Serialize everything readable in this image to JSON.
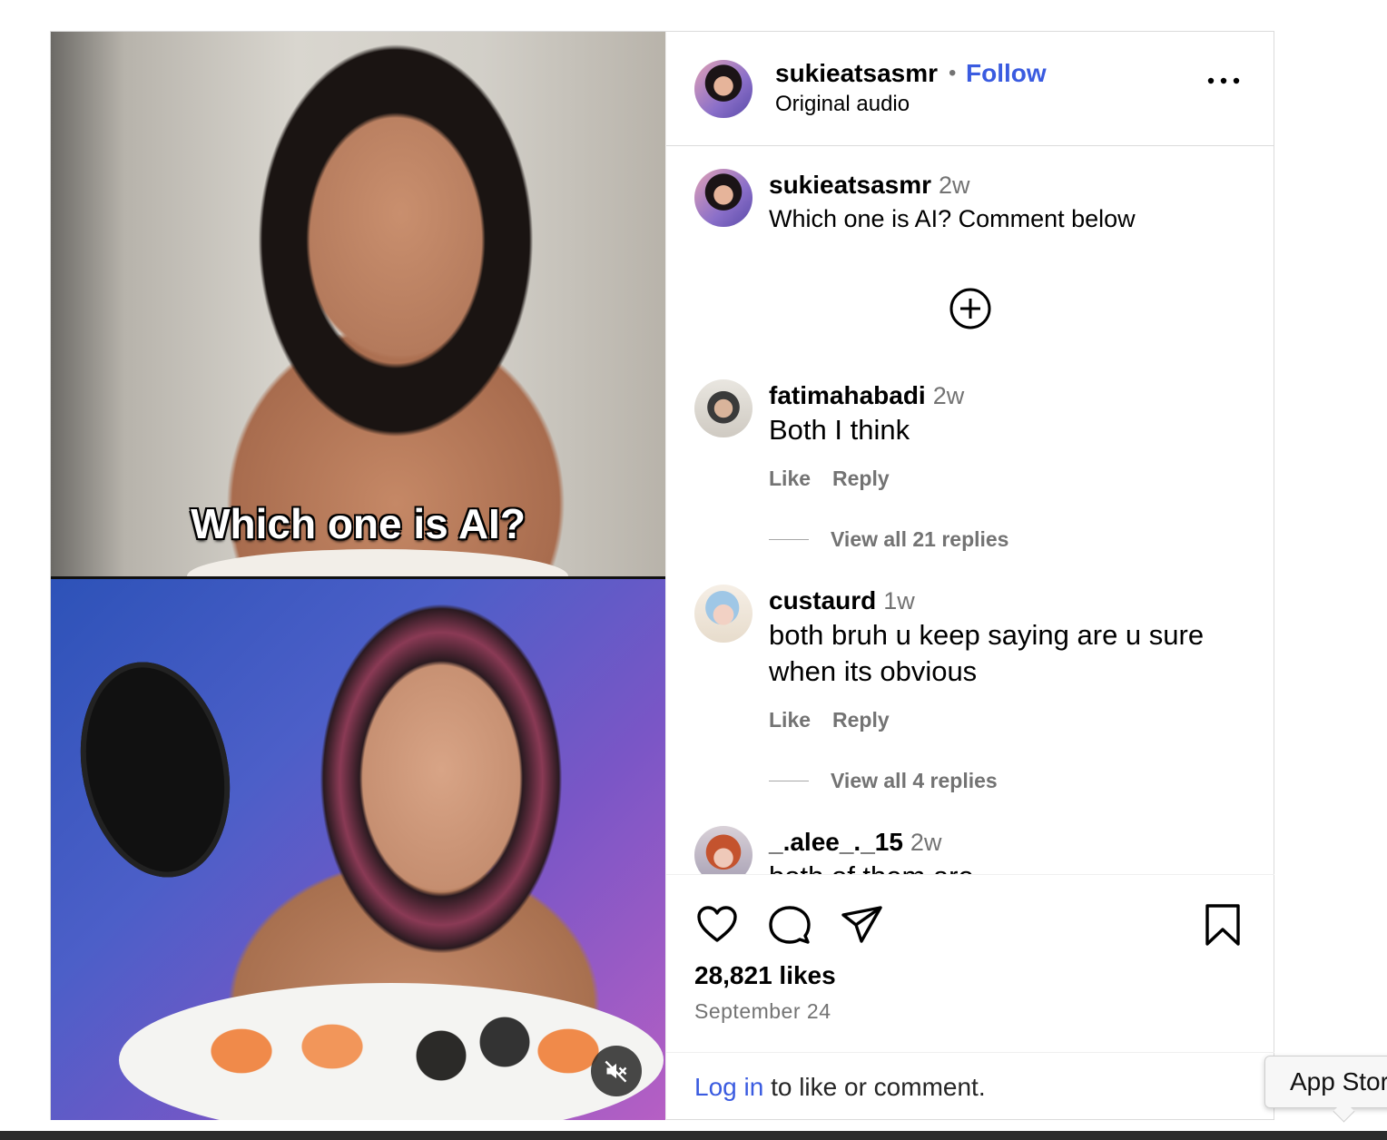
{
  "post": {
    "media": {
      "overlay_text": "Which one is AI?",
      "mute_icon": "muted-speaker-icon"
    },
    "header": {
      "username": "sukieatsasmr",
      "separator": "•",
      "follow_label": "Follow",
      "audio_label": "Original audio",
      "more_icon": "more-options-icon"
    },
    "caption": {
      "username": "sukieatsasmr",
      "time": "2w",
      "text": "Which one is AI? Comment below"
    },
    "add_icon": "add-circle-icon",
    "comments": [
      {
        "username": "fatimahabadi",
        "time": "2w",
        "text": "Both I think",
        "like_label": "Like",
        "reply_label": "Reply",
        "view_replies": "View all 21 replies"
      },
      {
        "username": "custaurd",
        "time": "1w",
        "text": "both bruh u keep saying are u sure when its obvious",
        "like_label": "Like",
        "reply_label": "Reply",
        "view_replies": "View all 4 replies"
      },
      {
        "username": "_.alee_._15",
        "time": "2w",
        "text": "both of them are"
      }
    ],
    "actions": {
      "icons": [
        "heart-icon",
        "comment-icon",
        "share-icon",
        "bookmark-icon"
      ],
      "likes": "28,821 likes",
      "date": "September 24"
    },
    "login_prompt": {
      "link": "Log in",
      "rest": " to like or comment."
    }
  },
  "tooltip": {
    "text": "App Store"
  },
  "colors": {
    "link_blue": "#3a5be0",
    "muted_gray": "#737373",
    "border": "#dbdbdb"
  }
}
